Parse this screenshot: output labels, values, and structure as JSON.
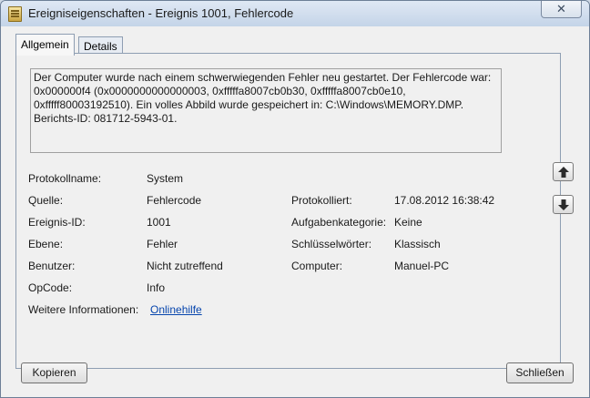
{
  "window": {
    "title": "Ereigniseigenschaften - Ereignis 1001, Fehlercode",
    "close_label": "✕"
  },
  "tabs": [
    {
      "label": "Allgemein"
    },
    {
      "label": "Details"
    }
  ],
  "description": "Der Computer wurde nach einem schwerwiegenden Fehler neu gestartet. Der Fehlercode war: 0x000000f4 (0x0000000000000003, 0xfffffa8007cb0b30, 0xfffffa8007cb0e10, 0xfffff80003192510). Ein volles Abbild wurde gespeichert in: C:\\Windows\\MEMORY.DMP. Berichts-ID: 081712-5943-01.",
  "fields": {
    "protokollname": {
      "label": "Protokollname:",
      "value": "System"
    },
    "quelle": {
      "label": "Quelle:",
      "value": "Fehlercode"
    },
    "protokolliert": {
      "label": "Protokolliert:",
      "value": "17.08.2012 16:38:42"
    },
    "ereignis_id": {
      "label": "Ereignis-ID:",
      "value": "1001"
    },
    "aufgabenkategorie": {
      "label": "Aufgabenkategorie:",
      "value": "Keine"
    },
    "ebene": {
      "label": "Ebene:",
      "value": "Fehler"
    },
    "schluesselwoerter": {
      "label": "Schlüsselwörter:",
      "value": "Klassisch"
    },
    "benutzer": {
      "label": "Benutzer:",
      "value": "Nicht zutreffend"
    },
    "computer": {
      "label": "Computer:",
      "value": "Manuel-PC"
    },
    "opcode": {
      "label": "OpCode:",
      "value": "Info"
    },
    "weitere": {
      "label": "Weitere Informationen:",
      "value": "Onlinehilfe"
    }
  },
  "buttons": {
    "copy": "Kopieren",
    "close": "Schließen"
  },
  "icons": {
    "up": "arrow-up-icon",
    "down": "arrow-down-icon"
  }
}
